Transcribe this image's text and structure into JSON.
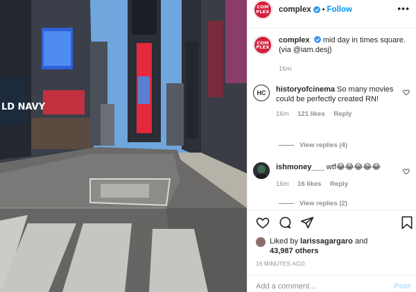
{
  "photo": {
    "description_icon": "photo-icon",
    "billboard_text": "LD NAVY"
  },
  "header": {
    "avatar_text": "COM PLEX",
    "username": "complex",
    "separator": "•",
    "follow_label": "Follow",
    "more_label": "•••"
  },
  "caption": {
    "username": "complex",
    "text": "mid day in times square. (via @iam.desj)",
    "time": "16m"
  },
  "comments": [
    {
      "avatar_text": "HC",
      "username": "historyofcinema",
      "text": "So many movies could be perfectly created RN!",
      "time": "16m",
      "likes": "121 likes",
      "reply": "Reply",
      "view_replies": "View replies (4)"
    },
    {
      "username": "ishmoney___",
      "text": "wtf😂😂😂😂😂",
      "time": "16m",
      "likes": "16 likes",
      "reply": "Reply",
      "view_replies": "View replies (2)"
    }
  ],
  "likes": {
    "prefix": "Liked by",
    "user": "larissagargaro",
    "and": "and",
    "count": "43,987 others"
  },
  "timestamp": "16 MINUTES AGO",
  "comment_box": {
    "placeholder": "Add a comment…",
    "post_label": "Post"
  },
  "colors": {
    "brand_red": "#d4203c",
    "link_blue": "#0095f6",
    "post_disabled": "#b2dffc",
    "muted": "#8e8e8e"
  }
}
